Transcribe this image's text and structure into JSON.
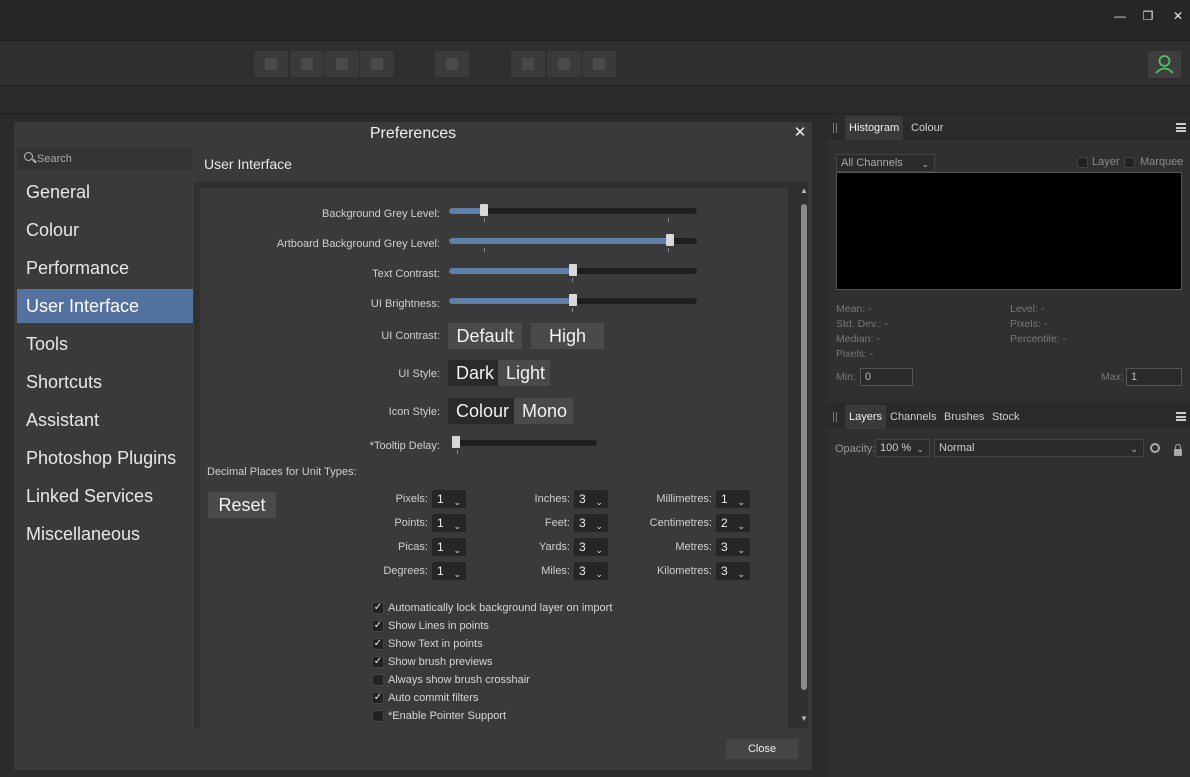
{
  "window": {
    "minimize": "—",
    "restore": "❐",
    "close": "✕"
  },
  "dialog": {
    "title": "Preferences",
    "close_glyph": "✕",
    "search_placeholder": "Search",
    "nav": [
      "General",
      "Colour",
      "Performance",
      "User Interface",
      "Tools",
      "Shortcuts",
      "Assistant",
      "Photoshop Plugins",
      "Linked Services",
      "Miscellaneous"
    ],
    "active_nav": "User Interface",
    "section_title": "User Interface",
    "sliders": [
      {
        "label": "Background Grey Level:",
        "value": 0.14
      },
      {
        "label": "Artboard Background Grey Level:",
        "value": 0.89
      },
      {
        "label": "Text Contrast:",
        "value": 0.5
      },
      {
        "label": "UI Brightness:",
        "value": 0.5
      }
    ],
    "ui_contrast": {
      "label": "UI Contrast:",
      "options": [
        "Default",
        "High"
      ]
    },
    "ui_style": {
      "label": "UI Style:",
      "options": [
        "Dark",
        "Light"
      ],
      "selected": "Light"
    },
    "icon_style": {
      "label": "Icon Style:",
      "options": [
        "Colour",
        "Mono"
      ],
      "selected": "Mono"
    },
    "tooltip_delay": {
      "label": "*Tooltip Delay:",
      "value": 0.02
    },
    "decimal_heading": "Decimal Places for Unit Types:",
    "reset": "Reset",
    "units": [
      {
        "label": "Pixels:",
        "value": "1"
      },
      {
        "label": "Points:",
        "value": "1"
      },
      {
        "label": "Picas:",
        "value": "1"
      },
      {
        "label": "Degrees:",
        "value": "1"
      },
      {
        "label": "Inches:",
        "value": "3"
      },
      {
        "label": "Feet:",
        "value": "3"
      },
      {
        "label": "Yards:",
        "value": "3"
      },
      {
        "label": "Miles:",
        "value": "3"
      },
      {
        "label": "Millimetres:",
        "value": "1"
      },
      {
        "label": "Centimetres:",
        "value": "2"
      },
      {
        "label": "Metres:",
        "value": "3"
      },
      {
        "label": "Kilometres:",
        "value": "3"
      }
    ],
    "checkboxes": [
      {
        "label": "Automatically lock background layer on import",
        "checked": true
      },
      {
        "label": "Show Lines in points",
        "checked": true
      },
      {
        "label": "Show Text in points",
        "checked": true
      },
      {
        "label": "Show brush previews",
        "checked": true
      },
      {
        "label": "Always show brush crosshair",
        "checked": false
      },
      {
        "label": "Auto commit filters",
        "checked": true
      },
      {
        "label": "*Enable Pointer Support",
        "checked": false
      }
    ],
    "close_button": "Close"
  },
  "histogram_panel": {
    "tabs": [
      "Histogram",
      "Colour"
    ],
    "channel": "All Channels",
    "layer": "Layer",
    "marquee": "Marquee",
    "stats_left": [
      "Mean: -",
      "Std. Dev.: -",
      "Median: -",
      "Pixels: -"
    ],
    "stats_right": [
      "Level: -",
      "Pixels: -",
      "Percentile: -"
    ],
    "min_label": "Min:",
    "min_value": "0",
    "max_label": "Max:",
    "max_value": "1"
  },
  "layers_panel": {
    "tabs": [
      "Layers",
      "Channels",
      "Brushes",
      "Stock"
    ],
    "opacity_label": "Opacity:",
    "opacity_value": "100 %",
    "blend_mode": "Normal"
  },
  "icons": {
    "chevron": "⌵",
    "check": "✓"
  }
}
